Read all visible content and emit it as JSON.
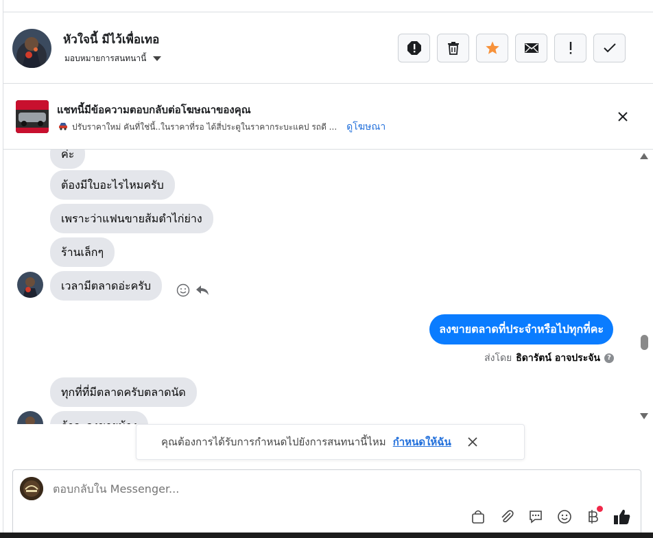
{
  "header": {
    "contact_name": "หัวใจนี้ มีไว้เพื่อเทอ",
    "assign_label": "มอบหมายการสนทนานี้",
    "actions": [
      {
        "name": "spam-icon"
      },
      {
        "name": "trash-icon"
      },
      {
        "name": "star-icon",
        "color": "#f7923b"
      },
      {
        "name": "mail-icon"
      },
      {
        "name": "important-icon"
      },
      {
        "name": "check-icon"
      }
    ]
  },
  "ad_banner": {
    "title": "แชทนี้มีข้อความตอบกลับต่อโฆษณาของคุณ",
    "snippet": "ปรับราคาใหม่ คันที่ใช่นี้..ในราคาที่รอ ได้สี่ประตูในราคากระบะแคป รถดี ...",
    "link": "ดูโฆษณา"
  },
  "messages": {
    "incoming_partial_top": "ค่ะ",
    "incoming": [
      "ต้องมีใบอะไรไหมครับ",
      "เพราะว่าแฟนขายส้มตำไก่ย่าง",
      "ร้านเล็กๆ",
      "เวลามีตลาดอ่ะครับ"
    ],
    "outgoing": "ลงขายตลาดที่ประจำหรือไปทุกที่คะ",
    "sent_by_label": "ส่งโดย",
    "sent_by_name": "ธิดารัตน์ อาจประจัน",
    "help_mark": "?",
    "incoming_after": "ทุกที่ที่มีตลาดครับตลาดนัด",
    "incoming_partial_bottom": "ถ้าจะลงขายน้าง"
  },
  "assign_prompt": {
    "text": "คุณต้องการได้รับการกำหนดไปยังการสนทนานี้ไหม",
    "link": "กำหนดให้ฉัน"
  },
  "composer": {
    "placeholder": "ตอบกลับใน Messenger...",
    "tools": [
      "shopping-bag-icon",
      "attachment-icon",
      "chat-bubble-icon",
      "emoji-icon",
      "baht-icon",
      "like-icon"
    ],
    "accent": "#0a7cff"
  }
}
